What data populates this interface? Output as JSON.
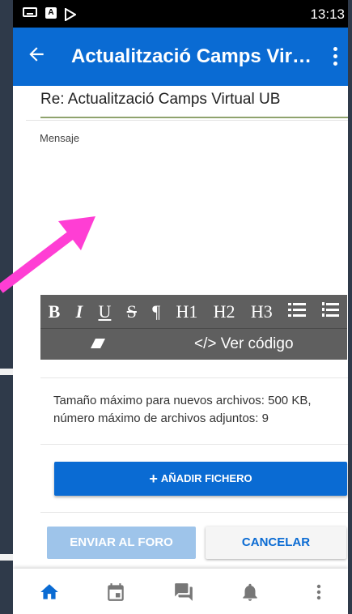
{
  "status_bar": {
    "time": "13:13",
    "notification_icons": [
      "keyboard-icon",
      "a-icon",
      "play-store-icon"
    ]
  },
  "app_bar": {
    "title": "Actualització Camps Virt...",
    "back_icon": "arrow-back-icon",
    "menu_icon": "more-vert-icon"
  },
  "form": {
    "subject_value": "Re: Actualització Camps Virtual UB",
    "message_placeholder": "Mensaje",
    "toolbar": {
      "buttons": [
        "B",
        "I",
        "U",
        "S",
        "¶",
        "H1",
        "H2",
        "H3",
        "bulleted-list-icon",
        "numbered-list-icon"
      ],
      "clear_format_icon": "eraser-icon",
      "code_label": "</> Ver código"
    },
    "attachments_info": "Tamaño máximo para nuevos archivos: 500 KB, número máximo de archivos adjuntos: 9",
    "add_file_label": "AÑADIR FICHERO",
    "send_label": "ENVIAR AL FORO",
    "cancel_label": "CANCELAR"
  },
  "bottom_nav": [
    "home-icon",
    "calendar-icon",
    "messages-icon",
    "notifications-icon",
    "more-icon"
  ],
  "colors": {
    "primary": "#0a6bd3",
    "send_disabled": "#9ec4ea",
    "toolbar": "#5f5f5f",
    "annotation_arrow": "#ff3ed4"
  }
}
